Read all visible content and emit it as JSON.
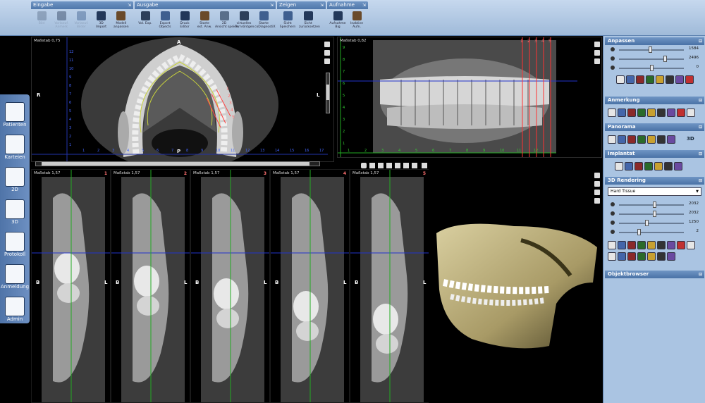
{
  "toolbar": {
    "groups": [
      {
        "title": "Eingabe",
        "buttons": [
          {
            "label": "Bild",
            "icon": "image-icon",
            "disabled": true
          },
          {
            "label": "Vorlaeuf.\nAnmerk",
            "icon": "skull-icon",
            "disabled": true
          },
          {
            "label": "Vorlaeuf.\nBilder",
            "icon": "skull-gray-icon",
            "disabled": true
          },
          {
            "label": "3D\nImport",
            "icon": "import-icon",
            "disabled": false
          },
          {
            "label": "Modell\nanpassen",
            "icon": "tooth-model-icon",
            "disabled": false
          }
        ]
      },
      {
        "title": "Ausgabe",
        "buttons": [
          {
            "label": "Vol. Exp.",
            "icon": "volume-export-icon",
            "disabled": false
          },
          {
            "label": "Export\nObjects",
            "icon": "export-objects-icon",
            "disabled": false
          },
          {
            "label": "Druck\nEditor",
            "icon": "print-icon",
            "disabled": false
          },
          {
            "label": "Starte\next. Anw.",
            "icon": "external-app-icon",
            "disabled": false
          },
          {
            "label": "2D\nAnsicht speich.",
            "icon": "save-2d-view-icon",
            "disabled": false
          },
          {
            "label": "virtuelles\nFernröntgen",
            "icon": "virtual-ceph-icon",
            "disabled": false
          },
          {
            "label": "Starte\ncoDiagnostiX",
            "icon": "codiagnostix-icon",
            "disabled": false
          }
        ]
      },
      {
        "title": "Zeigen",
        "buttons": [
          {
            "label": "Sicht\nSpeichern",
            "icon": "save-view-icon",
            "disabled": false
          },
          {
            "label": "Sicht\nzurücksetzen",
            "icon": "reset-view-icon",
            "disabled": false
          }
        ]
      },
      {
        "title": "Aufnahme",
        "buttons": [
          {
            "label": "Aufnahme\nBig",
            "icon": "capture-icon",
            "disabled": false
          },
          {
            "label": "Inaktive\nAufn.",
            "icon": "inactive-capture-icon",
            "disabled": false
          }
        ]
      }
    ]
  },
  "nav": [
    {
      "label": "Patienten",
      "icon": "patients-icon"
    },
    {
      "label": "Karteien",
      "icon": "records-icon"
    },
    {
      "label": "2D",
      "icon": "2d-icon"
    },
    {
      "label": "3D",
      "icon": "3d-cube-icon"
    },
    {
      "label": "Protokoll",
      "icon": "protocol-icon"
    },
    {
      "label": "Anmeldung",
      "icon": "login-arrow-icon"
    },
    {
      "label": "Admin",
      "icon": "admin-icon"
    }
  ],
  "axial": {
    "scale": "Maßstab 0,75",
    "top": "A",
    "bottom": "P",
    "left": "R",
    "right": "L",
    "markers": [
      "1",
      "2",
      "3",
      "4",
      "5"
    ],
    "axis_ticks": [
      "1",
      "2",
      "3",
      "4",
      "5",
      "6",
      "7",
      "8",
      "9",
      "10",
      "11",
      "12",
      "13",
      "14",
      "15",
      "16",
      "17",
      "18"
    ],
    "v_ticks": [
      "12",
      "11",
      "10",
      "9",
      "8",
      "7",
      "6",
      "5",
      "4",
      "3",
      "2",
      "1"
    ]
  },
  "panorama": {
    "scale": "Maßstab 0,82",
    "markers": [
      "1",
      "2",
      "3",
      "4",
      "5"
    ],
    "axis_ticks": [
      "1",
      "2",
      "3",
      "4",
      "5",
      "6",
      "7",
      "8",
      "9",
      "10",
      "11",
      "12"
    ],
    "v_ticks": [
      "9",
      "8",
      "7",
      "6",
      "5",
      "4",
      "3",
      "2",
      "1"
    ]
  },
  "cross_sections": [
    {
      "scale": "Maßstab 1,57",
      "number": "1",
      "left": "B",
      "right": "L"
    },
    {
      "scale": "Maßstab 1,57",
      "number": "2",
      "left": "B",
      "right": "L"
    },
    {
      "scale": "Maßstab 1,57",
      "number": "3",
      "left": "B",
      "right": "L"
    },
    {
      "scale": "Maßstab 1,57",
      "number": "4",
      "left": "B",
      "right": "L"
    },
    {
      "scale": "Maßstab 1,57",
      "number": "5",
      "left": "B",
      "right": "L"
    }
  ],
  "right_panel": {
    "anpassen": {
      "title": "Anpassen",
      "sliders": [
        "1584",
        "2496",
        "0"
      ],
      "slider_levels": [
        0.48,
        0.72,
        0.5
      ]
    },
    "anmerkung": {
      "title": "Anmerkung"
    },
    "panorama": {
      "title": "Panorama",
      "label_3d": "3D"
    },
    "implantat": {
      "title": "Implantat"
    },
    "rendering": {
      "title": "3D Rendering",
      "dropdown": "Hard Tissue",
      "sliders": [
        "2032",
        "2032",
        "1250",
        "2"
      ],
      "slider_levels": [
        0.55,
        0.55,
        0.42,
        0.3
      ]
    },
    "objektbrowser": {
      "title": "Objektbrowser"
    }
  }
}
